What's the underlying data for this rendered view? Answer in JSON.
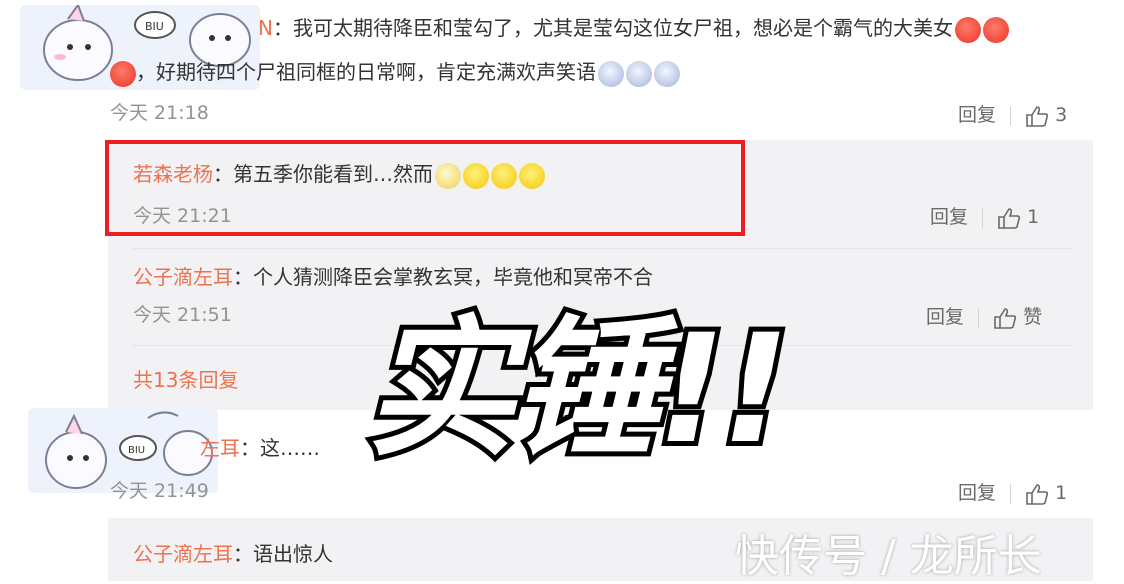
{
  "comments": [
    {
      "username_partial": "N",
      "text_line1": "：我可太期待降臣和莹勾了，尤其是莹勾这位女尸祖，想必是个霸气的大美女",
      "text_line2": "，好期待四个尸祖同框的日常啊，肯定充满欢声笑语",
      "time": "今天 21:18",
      "reply_label": "回复",
      "like_count": "3",
      "replies": [
        {
          "username": "若森老杨",
          "text": "：第五季你能看到…然而",
          "time": "今天 21:21",
          "reply_label": "回复",
          "like_count": "1"
        },
        {
          "username": "公子滴左耳",
          "text": "：个人猜测降臣会掌教玄冥，毕竟他和冥帝不合",
          "time": "今天 21:51",
          "reply_label": "回复",
          "like_count": "赞"
        }
      ],
      "more_replies": "共13条回复"
    },
    {
      "username_partial": "左耳",
      "text": "：这……",
      "time": "今天 21:49",
      "reply_label": "回复",
      "like_count": "1",
      "replies": [
        {
          "username": "公子滴左耳",
          "text": "：语出惊人"
        }
      ]
    }
  ],
  "overlay": {
    "text": "实锤!!"
  },
  "watermark": {
    "text": "快传号 / 龙所长"
  },
  "colors": {
    "username": "#eb7350",
    "highlight_box": "#ee1d24",
    "reply_bg": "#f2f2f5"
  }
}
